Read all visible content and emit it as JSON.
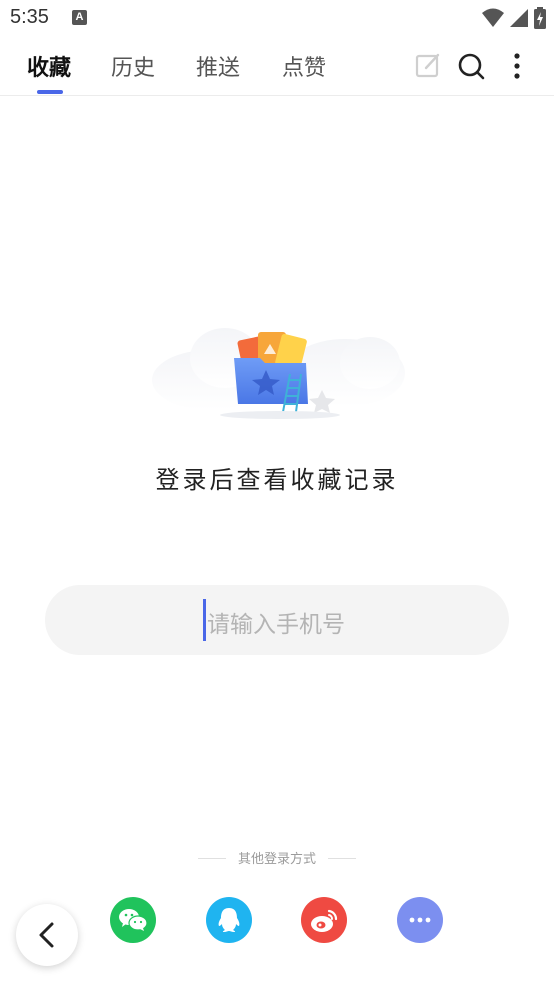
{
  "status_bar": {
    "time": "5:35",
    "notification_letter": "A"
  },
  "tabs": [
    {
      "label": "收藏",
      "active": true
    },
    {
      "label": "历史",
      "active": false
    },
    {
      "label": "推送",
      "active": false
    },
    {
      "label": "点赞",
      "active": false
    }
  ],
  "header_icons": [
    "edit-icon",
    "search-icon",
    "more-vertical-icon"
  ],
  "prompt": "登录后查看收藏记录",
  "phone_input": {
    "placeholder": "请输入手机号",
    "value": ""
  },
  "other_login": {
    "label": "其他登录方式",
    "methods": [
      {
        "name": "wechat-icon",
        "color": "#20c35c"
      },
      {
        "name": "qq-icon",
        "color": "#1fb4f0"
      },
      {
        "name": "weibo-icon",
        "color": "#ef4a42"
      },
      {
        "name": "more-icon",
        "color": "#7c8ff0"
      }
    ]
  },
  "colors": {
    "accent": "#4a67e8"
  }
}
